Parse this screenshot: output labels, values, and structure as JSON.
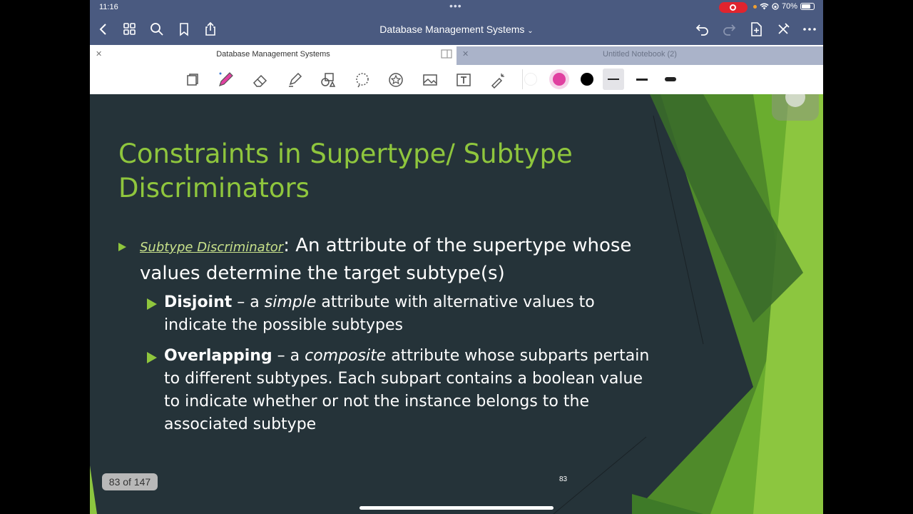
{
  "status": {
    "time": "11:16",
    "battery": "70%"
  },
  "nav": {
    "title": "Database Management Systems",
    "dropdown_icon": "chevron-down-icon",
    "left_icons": [
      "back-icon",
      "grid-icon",
      "search-icon",
      "bookmark-icon",
      "share-icon"
    ],
    "right_icons": [
      "undo-icon",
      "redo-icon",
      "add-page-icon",
      "close-pen-icon",
      "more-icon"
    ]
  },
  "tabs": [
    {
      "label": "Database Management Systems",
      "active": true
    },
    {
      "label": "Untitled Notebook (2)",
      "active": false
    }
  ],
  "toolbar": {
    "tools": [
      "lasso-book-icon",
      "pen-icon",
      "eraser-icon",
      "highlighter-icon",
      "shapes-icon",
      "lasso-icon",
      "sticker-icon",
      "image-icon",
      "text-icon",
      "laser-icon"
    ],
    "colors": [
      "#ffffff",
      "#e040a0",
      "#000000"
    ],
    "active_color": "#e040a0",
    "stroke_widths": [
      "thin",
      "medium",
      "thick"
    ]
  },
  "slide": {
    "title": "Constraints in Supertype/ Subtype Discriminators",
    "bullet1": {
      "term": "Subtype Discriminator",
      "text": ": An attribute of the supertype whose values determine the target subtype(s)"
    },
    "bullet2": {
      "term": "Disjoint",
      "dash": " – a ",
      "emph": "simple",
      "rest": " attribute with alternative values to indicate the possible subtypes"
    },
    "bullet3": {
      "term": "Overlapping",
      "dash": " – a ",
      "emph": "composite",
      "rest": " attribute whose subparts pertain to different subtypes. Each subpart contains a boolean value to indicate whether or not the instance belongs to the associated subtype"
    },
    "page_indicator": "83 of 147",
    "slide_number": "83",
    "accent_color": "#8fc63d"
  }
}
